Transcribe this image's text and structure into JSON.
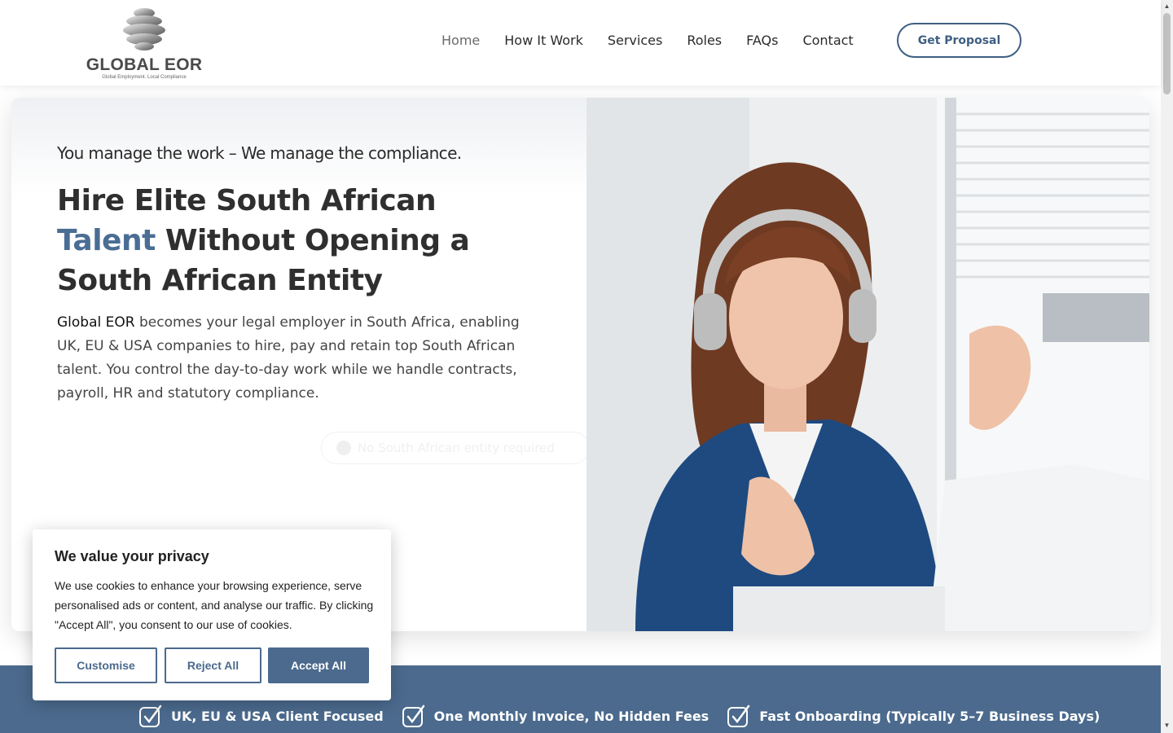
{
  "brand": {
    "name": "GLOBAL EOR",
    "tagline": "Global Employment. Local Compliance"
  },
  "nav": {
    "items": [
      {
        "label": "Home",
        "active": true
      },
      {
        "label": "How It Work"
      },
      {
        "label": "Services"
      },
      {
        "label": "Roles"
      },
      {
        "label": "FAQs"
      },
      {
        "label": "Contact"
      }
    ],
    "cta_label": "Get Proposal"
  },
  "hero": {
    "tagline": "You manage the work – We manage the compliance.",
    "title_line1": "Hire Elite South African",
    "title_accent": "Talent",
    "title_rest": " Without Opening a South African Entity",
    "desc_strong": "Global EOR",
    "desc_rest": " becomes your legal employer in South Africa, enabling UK, EU & USA companies to hire, pay and retain top South African talent. You control the day-to-day work while we handle contracts, payroll, HR and statutory compliance.",
    "faded_badge": "No South African entity required"
  },
  "band": {
    "items": [
      "UK, EU & USA Client Focused",
      "One Monthly Invoice, No Hidden Fees",
      "Fast Onboarding (Typically 5–7 Business Days)"
    ]
  },
  "cookie": {
    "title": "We value your privacy",
    "text": "We use cookies to enhance your browsing experience, serve personalised ads or content, and analyse our traffic. By clicking \"Accept All\", you consent to our use of cookies.",
    "customise": "Customise",
    "reject": "Reject All",
    "accept": "Accept All"
  },
  "colors": {
    "brand_blue": "#4b6a8d",
    "accent_text": "#4a6d94"
  }
}
